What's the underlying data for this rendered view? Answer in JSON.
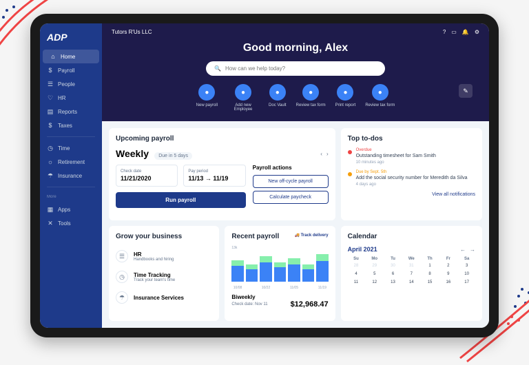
{
  "company": "Tutors R'Us LLC",
  "logo": "ADP",
  "sidebar": {
    "items": [
      {
        "icon": "⌂",
        "label": "Home"
      },
      {
        "icon": "$",
        "label": "Payroll"
      },
      {
        "icon": "☰",
        "label": "People"
      },
      {
        "icon": "♡",
        "label": "HR"
      },
      {
        "icon": "▤",
        "label": "Reports"
      },
      {
        "icon": "$",
        "label": "Taxes"
      }
    ],
    "items2": [
      {
        "icon": "◷",
        "label": "Time"
      },
      {
        "icon": "☼",
        "label": "Retirement"
      },
      {
        "icon": "☂",
        "label": "Insurance"
      }
    ],
    "more_label": "More",
    "items3": [
      {
        "icon": "▦",
        "label": "Apps"
      },
      {
        "icon": "✕",
        "label": "Tools"
      }
    ]
  },
  "greeting": "Good morning, Alex",
  "search_placeholder": "How can we help today?",
  "quick_actions": [
    {
      "label": "New payroll"
    },
    {
      "label": "Add new Employee"
    },
    {
      "label": "Doc Vault"
    },
    {
      "label": "Review tax form"
    },
    {
      "label": "Print report"
    },
    {
      "label": "Review tax form"
    }
  ],
  "upcoming": {
    "title": "Upcoming payroll",
    "freq": "Weekly",
    "due": "Due in 5 days",
    "check_label": "Check date",
    "check_date": "11/21/2020",
    "period_label": "Pay period",
    "period": "11/13 → 11/19",
    "run": "Run payroll",
    "actions_title": "Payroll actions",
    "action1": "New off-cycle payroll",
    "action2": "Calculate paycheck"
  },
  "todos": {
    "title": "Top to-dos",
    "items": [
      {
        "tag": "Overdue",
        "text": "Outstanding timesheet for Sam Smith",
        "time": "10 minutes ago",
        "color": "red"
      },
      {
        "tag": "Due by Sept. 5th",
        "text": "Add the social security number for Meredith da Silva",
        "time": "4 days ago",
        "color": "orange"
      }
    ],
    "view_all": "View all notifications"
  },
  "grow": {
    "title": "Grow your business",
    "items": [
      {
        "icon": "☰",
        "title": "HR",
        "sub": "Handbooks and hiring"
      },
      {
        "icon": "◷",
        "title": "Time Tracking",
        "sub": "Track your team's time"
      },
      {
        "icon": "☂",
        "title": "Insurance Services",
        "sub": ""
      }
    ]
  },
  "recent": {
    "title": "Recent payroll",
    "track": "Track delivery",
    "freq": "Biweekly",
    "sub": "Check date: Nov 11",
    "amount": "$12,968.47"
  },
  "calendar": {
    "title": "Calendar",
    "month": "April 2021",
    "dow": [
      "Su",
      "Mo",
      "Tu",
      "We",
      "Th",
      "Fr",
      "Sa"
    ],
    "days": [
      {
        "n": "28",
        "dim": true
      },
      {
        "n": "29",
        "dim": true
      },
      {
        "n": "30",
        "dim": true
      },
      {
        "n": "31",
        "dim": true
      },
      {
        "n": "1"
      },
      {
        "n": "2"
      },
      {
        "n": "3"
      },
      {
        "n": "4"
      },
      {
        "n": "5"
      },
      {
        "n": "6"
      },
      {
        "n": "7"
      },
      {
        "n": "8"
      },
      {
        "n": "9"
      },
      {
        "n": "10"
      },
      {
        "n": "11"
      },
      {
        "n": "12"
      },
      {
        "n": "13"
      },
      {
        "n": "14"
      },
      {
        "n": "15"
      },
      {
        "n": "16"
      },
      {
        "n": "17"
      }
    ]
  },
  "chart_data": {
    "type": "bar",
    "categories": [
      "10/08",
      "",
      "10/22",
      "",
      "11/05",
      "",
      "11/19"
    ],
    "values": [
      10,
      8,
      12,
      9,
      11,
      8,
      13
    ],
    "title": "Recent payroll",
    "ylabel": ""
  }
}
